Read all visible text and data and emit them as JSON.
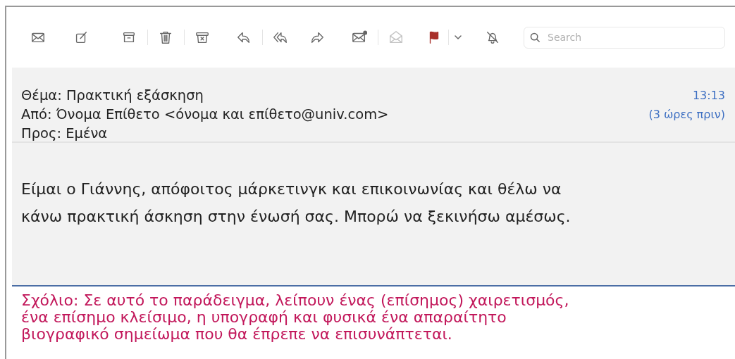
{
  "toolbar": [
    {
      "disabled": false
    },
    {
      "disabled": false
    },
    {
      "disabled": false
    },
    {
      "disabled": false
    },
    {
      "disabled": false
    },
    {
      "disabled": false
    },
    {
      "disabled": false
    },
    {
      "disabled": false
    },
    {
      "disabled": false
    },
    {
      "disabled": true
    },
    {
      "disabled": false
    },
    {
      "disabled": false
    },
    {
      "disabled": false
    }
  ],
  "search": {
    "placeholder": "Search"
  },
  "message": {
    "subject": "Θέμα: Πρακτική εξάσκηση",
    "from": "Από: Όνομα Επίθετο <όνομα και επίθετο@univ.com>",
    "to": "Προς: Εμένα",
    "time": "13:13",
    "relative_time": "(3 ώρες πριν)",
    "body": "Είμαι ο Γιάννης, απόφοιτος μάρκετινγκ και επικοινωνίας και θέλω να κάνω πρακτική άσκηση στην ένωσή σας. Μπορώ να ξεκινήσω αμέσως."
  },
  "comment": "Σχόλιο: Σε αυτό το παράδειγμα, λείπουν ένας (επίσημος) χαιρετισμός, ένα επίσημο κλείσιμο, η υπογραφή και φυσικά ένα απαραίτητο βιογραφικό σημείωμα που θα έπρεπε να επισυνάπτεται."
}
